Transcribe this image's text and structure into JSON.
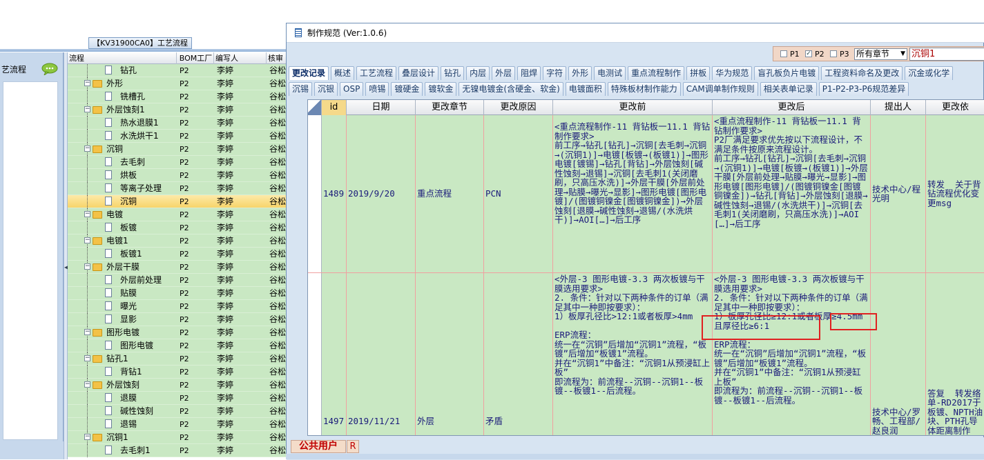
{
  "left_panel": {
    "flow_title": "【KV31900CA0】工艺流程",
    "side_item": "艺流程",
    "tree_headers": [
      "流程",
      "BOM工厂",
      "编写人",
      "核审"
    ],
    "rows": [
      {
        "name": "钻孔",
        "level": 2,
        "type": "doc",
        "bom": "P2",
        "writer": "李婷",
        "reviewer": "谷松"
      },
      {
        "name": "外形",
        "level": 1,
        "type": "folder",
        "bom": "P2",
        "writer": "李婷",
        "reviewer": "谷松"
      },
      {
        "name": "铣槽孔",
        "level": 2,
        "type": "doc",
        "bom": "P2",
        "writer": "李婷",
        "reviewer": "谷松"
      },
      {
        "name": "外层蚀刻1",
        "level": 1,
        "type": "folder",
        "bom": "P2",
        "writer": "李婷",
        "reviewer": "谷松"
      },
      {
        "name": "热水退膜1",
        "level": 2,
        "type": "doc",
        "bom": "P2",
        "writer": "李婷",
        "reviewer": "谷松"
      },
      {
        "name": "水洗烘干1",
        "level": 2,
        "type": "doc",
        "bom": "P2",
        "writer": "李婷",
        "reviewer": "谷松"
      },
      {
        "name": "沉铜",
        "level": 1,
        "type": "folder",
        "bom": "P2",
        "writer": "李婷",
        "reviewer": "谷松"
      },
      {
        "name": "去毛刺",
        "level": 2,
        "type": "doc",
        "bom": "P2",
        "writer": "李婷",
        "reviewer": "谷松"
      },
      {
        "name": "烘板",
        "level": 2,
        "type": "doc",
        "bom": "P2",
        "writer": "李婷",
        "reviewer": "谷松"
      },
      {
        "name": "等离子处理",
        "level": 2,
        "type": "doc",
        "bom": "P2",
        "writer": "李婷",
        "reviewer": "谷松"
      },
      {
        "name": "沉铜",
        "level": 2,
        "type": "doc",
        "bom": "P2",
        "writer": "李婷",
        "reviewer": "谷松",
        "selected": true
      },
      {
        "name": "电镀",
        "level": 1,
        "type": "folder",
        "bom": "P2",
        "writer": "李婷",
        "reviewer": "谷松"
      },
      {
        "name": "板镀",
        "level": 2,
        "type": "doc",
        "bom": "P2",
        "writer": "李婷",
        "reviewer": "谷松"
      },
      {
        "name": "电镀1",
        "level": 1,
        "type": "folder",
        "bom": "P2",
        "writer": "李婷",
        "reviewer": "谷松"
      },
      {
        "name": "板镀1",
        "level": 2,
        "type": "doc",
        "bom": "P2",
        "writer": "李婷",
        "reviewer": "谷松"
      },
      {
        "name": "外层干膜",
        "level": 1,
        "type": "folder",
        "bom": "P2",
        "writer": "李婷",
        "reviewer": "谷松"
      },
      {
        "name": "外层前处理",
        "level": 2,
        "type": "doc",
        "bom": "P2",
        "writer": "李婷",
        "reviewer": "谷松"
      },
      {
        "name": "贴膜",
        "level": 2,
        "type": "doc",
        "bom": "P2",
        "writer": "李婷",
        "reviewer": "谷松"
      },
      {
        "name": "曝光",
        "level": 2,
        "type": "doc",
        "bom": "P2",
        "writer": "李婷",
        "reviewer": "谷松"
      },
      {
        "name": "显影",
        "level": 2,
        "type": "doc",
        "bom": "P2",
        "writer": "李婷",
        "reviewer": "谷松"
      },
      {
        "name": "图形电镀",
        "level": 1,
        "type": "folder",
        "bom": "P2",
        "writer": "李婷",
        "reviewer": "谷松"
      },
      {
        "name": "图形电镀",
        "level": 2,
        "type": "doc",
        "bom": "P2",
        "writer": "李婷",
        "reviewer": "谷松"
      },
      {
        "name": "钻孔1",
        "level": 1,
        "type": "folder",
        "bom": "P2",
        "writer": "李婷",
        "reviewer": "谷松"
      },
      {
        "name": "背钻1",
        "level": 2,
        "type": "doc",
        "bom": "P2",
        "writer": "李婷",
        "reviewer": "谷松"
      },
      {
        "name": "外层蚀刻",
        "level": 1,
        "type": "folder",
        "bom": "P2",
        "writer": "李婷",
        "reviewer": "谷松"
      },
      {
        "name": "退膜",
        "level": 2,
        "type": "doc",
        "bom": "P2",
        "writer": "李婷",
        "reviewer": "谷松"
      },
      {
        "name": "碱性蚀刻",
        "level": 2,
        "type": "doc",
        "bom": "P2",
        "writer": "李婷",
        "reviewer": "谷松"
      },
      {
        "name": "退锡",
        "level": 2,
        "type": "doc",
        "bom": "P2",
        "writer": "李婷",
        "reviewer": "谷松"
      },
      {
        "name": "沉铜1",
        "level": 1,
        "type": "folder",
        "bom": "P2",
        "writer": "李婷",
        "reviewer": "谷松"
      },
      {
        "name": "去毛刺1",
        "level": 2,
        "type": "doc",
        "bom": "P2",
        "writer": "李婷",
        "reviewer": "谷松"
      }
    ]
  },
  "dialog": {
    "title": "制作规范 (Ver:1.0.6)",
    "filters": [
      {
        "label": "P1",
        "checked": false
      },
      {
        "label": "P2",
        "checked": true
      },
      {
        "label": "P3",
        "checked": false
      }
    ],
    "chapter_select": "所有章节",
    "search_value": "沉铜1",
    "tabs_row1": [
      "更改记录",
      "概述",
      "工艺流程",
      "叠层设计",
      "钻孔",
      "内层",
      "外层",
      "阻焊",
      "字符",
      "外形",
      "电测试",
      "重点流程制作",
      "拼板",
      "华为规范",
      "盲孔板负片电镀",
      "工程资料命名及更改",
      "沉金或化学"
    ],
    "active_tab": "更改记录",
    "tabs_row2": [
      "沉锡",
      "沉银",
      "OSP",
      "喷锡",
      "镀硬金",
      "镀软金",
      "无镍电镀金(含硬金、软金)",
      "电镀面积",
      "特殊板材制作能力",
      "CAM调单制作规则",
      "相关表单记录",
      "P1-P2-P3-P6规范差异"
    ],
    "grid_headers": [
      "id",
      "日期",
      "更改章节",
      "更改原因",
      "更改前",
      "更改后",
      "提出人",
      "更改依"
    ],
    "grid_rows": [
      {
        "id": "1489",
        "date": "2019/9/20",
        "chapter": "重点流程",
        "reason": "PCN",
        "before": "<重点流程制作-11 背钻板一11.1 背钻制作要求>\n前工序→钻孔[钻孔]→沉铜[去毛刺→沉铜→(沉铜1)]→电镀[板镀→(板镀1)]→图形电镀[镀锡]→钻孔[背钻]→外层蚀刻[碱性蚀刻→退锡]→沉铜[去毛刺1(关闭磨刷，只高压水洗)]→外层干膜[外层前处理→贴膜→曝光→显影]→图形电镀[图形电镀]/(图镀铜镍金[图镀铜镍金])→外层蚀刻[退膜→碱性蚀刻→退锡/(水洗烘干)]→AOI[…]→后工序",
        "after": "<重点流程制作-11 背钻板一11.1 背钻制作要求>\nP2厂满足要求优先按以下流程设计，不满足条件按原来流程设计。\n前工序→钻孔[钻孔]→沉铜[去毛刺→沉铜→(沉铜1)]→电镀[板镀→(板镀1)]→外层干膜[外层前处理→贴膜→曝光→显影]→图形电镀[图形电镀]/(图镀铜镍金[图镀铜镍金])→钻孔[背钻]→外层蚀刻[退膜→碱性蚀刻→退锡/(水洗烘干)]→沉铜[去毛刺1(关闭磨刷，只高压水洗)]→AOI[…]→后工序",
        "proposer": "技术中心/程光明",
        "basis": "转发  关于背钻流程优化变更msg"
      },
      {
        "id": "1497",
        "date": "2019/11/21",
        "chapter": "外层",
        "reason": "矛盾",
        "before": "<外层-3 图形电镀-3.3 两次板镀与干膜选用要求>\n2. 条件：针对以下两种条件的订单（满足其中一种即按要求）：\n1）板厚孔径比>12:1或者板厚>4mm\n\nERP流程：\n统一在“沉铜”后增加“沉铜1”流程，“板镀”后增加“板镀1”流程。\n并在“沉铜1”中备注：“沉铜1从预浸缸上板”\n即流程为：前流程--沉铜--沉铜1--板镀--板镀1--后流程。",
        "after": "<外层-3 图形电镀-3.3 两次板镀与干膜选用要求>\n2. 条件：针对以下两种条件的订单（满足其中一种即按要求）：\n1）板厚孔径比≥12:1或者板厚≥4.5mm且厚径比≥6:1\n\nERP流程：\n统一在“沉铜”后增加“沉铜1”流程，“板镀”后增加“板镀1”流程。\n并在“沉铜1”中备注：“沉铜1从预浸缸上板”\n即流程为：前流程--沉铜--沉铜1--板镀--板镀1--后流程。",
        "proposer": "技术中心/罗畅、工程部/赵良润",
        "basis": "答复  转发络单-RD2017于板镀、NPTH油块、PTH孔导体距离制作"
      }
    ],
    "user_label": "公共用户",
    "r_label": "R"
  },
  "colors": {
    "row_green": "#c9e8c3",
    "selected_row": "#f7d46a",
    "highlight_red": "#e02020",
    "text_blue": "#1a1a7a"
  }
}
